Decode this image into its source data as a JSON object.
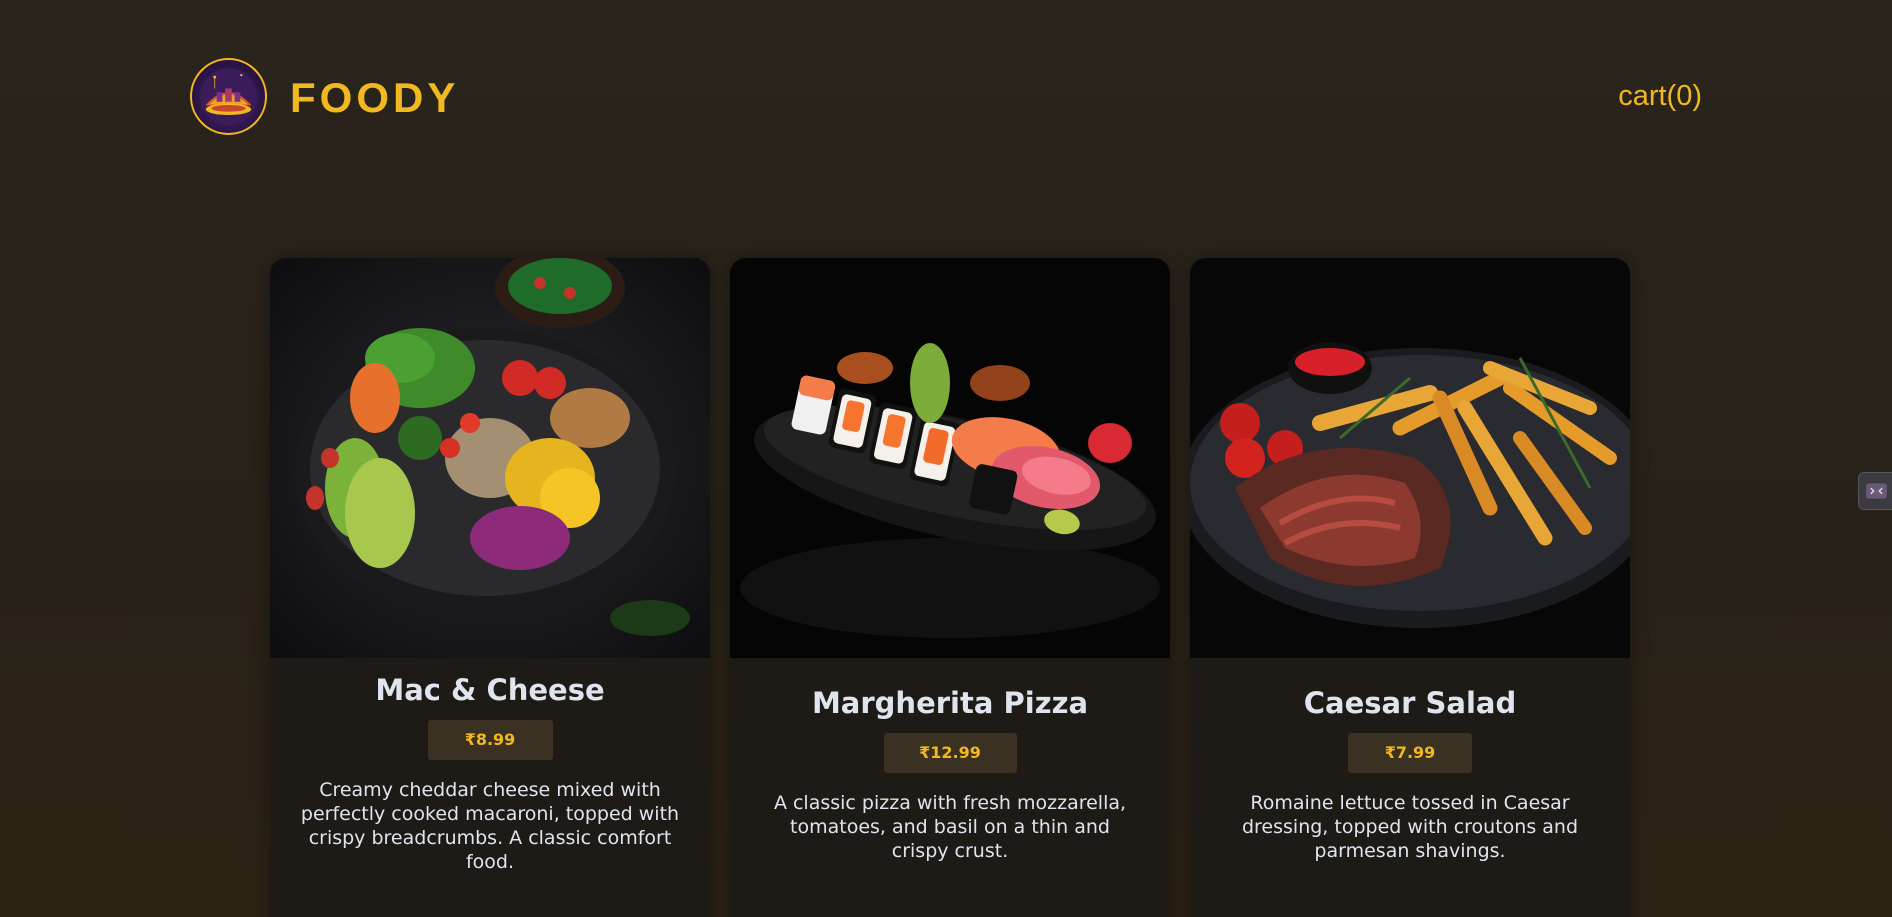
{
  "brand": {
    "name": "FOODY",
    "logo_icon": "food-logo-icon",
    "accent_color": "#f2b81f"
  },
  "header": {
    "cart_label": "cart(0)"
  },
  "products": [
    {
      "title": "Mac & Cheese",
      "price": "₹8.99",
      "description": "Creamy cheddar cheese mixed with perfectly cooked macaroni, topped with crispy breadcrumbs. A classic comfort food.",
      "image": "vegetable-bowl-image"
    },
    {
      "title": "Margherita Pizza",
      "price": "₹12.99",
      "description": "A classic pizza with fresh mozzarella, tomatoes, and basil on a thin and crispy crust.",
      "image": "sushi-platter-image"
    },
    {
      "title": "Caesar Salad",
      "price": "₹7.99",
      "description": "Romaine lettuce tossed in Caesar dressing, topped with croutons and parmesan shavings.",
      "image": "steak-fries-image"
    }
  ],
  "side_tab": {
    "icon": "extension-icon"
  }
}
